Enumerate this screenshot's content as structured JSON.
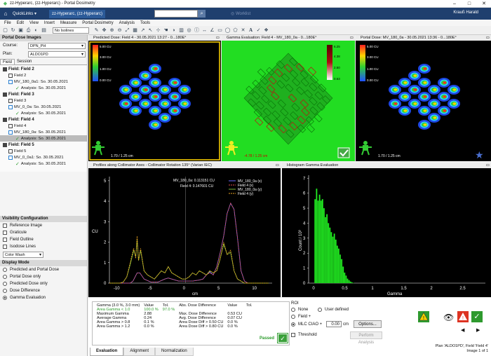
{
  "window": {
    "title": "zz-Hyperarc, (zz-Hyperarc) - Portal Dosimetry",
    "minimize": "–",
    "maximize": "□",
    "close": "✕"
  },
  "ribbon": {
    "quicklinks": "QuickLinks ▾",
    "patient_tab": "zz-Hyperarc, (zz-Hyperarc)",
    "worklist": "Worklist",
    "user": "Krauß Harald"
  },
  "menu": [
    "File",
    "Edit",
    "View",
    "Insert",
    "Measure",
    "Portal Dosimetry",
    "Analysis",
    "Tools"
  ],
  "toolbar": {
    "isolines": "No Isolines"
  },
  "left_panel": {
    "header": "Portal Dose Images",
    "course_label": "Course:",
    "course_value": "DPN_PH",
    "plan_label": "Plan:",
    "plan_value": "ALDO1PD",
    "tabs": [
      "Field",
      "Session"
    ],
    "tree": [
      {
        "field": "Field: Field 2",
        "items": [
          {
            "label": "Field 2",
            "kind": "box"
          },
          {
            "label": "MV_180_0a1: So. 30.05.2021",
            "kind": "doc"
          },
          {
            "label": "Analysis: So. 30.05.2021",
            "kind": "check"
          }
        ]
      },
      {
        "field": "Field: Field 3",
        "items": [
          {
            "label": "Field 3",
            "kind": "box"
          },
          {
            "label": "MV_0_0a: So. 30.05.2021",
            "kind": "doc"
          },
          {
            "label": "Analysis: So. 30.05.2021",
            "kind": "check"
          }
        ]
      },
      {
        "field": "Field: Field 4",
        "items": [
          {
            "label": "Field 4",
            "kind": "box"
          },
          {
            "label": "MV_180_0a: So. 30.05.2021",
            "kind": "doc"
          },
          {
            "label": "Analysis: So. 30.05.2021",
            "kind": "check",
            "selected": true
          }
        ]
      },
      {
        "field": "Field: Field 5",
        "items": [
          {
            "label": "Field 5",
            "kind": "box"
          },
          {
            "label": "MV_0_0a1: So. 30.05.2021",
            "kind": "doc"
          },
          {
            "label": "Analysis: So. 30.05.2021",
            "kind": "check"
          }
        ]
      }
    ],
    "visibility_header": "Visibility Configuration",
    "visibility": [
      "Reference Image",
      "Graticule",
      "Field Outline",
      "Isodose Lines"
    ],
    "color_mode": "Color Wash",
    "display_header": "Display Mode",
    "display_modes": [
      {
        "label": "Predicted and Portal Dose",
        "on": false
      },
      {
        "label": "Portal Dose only",
        "on": false
      },
      {
        "label": "Predicted Dose only",
        "on": false
      },
      {
        "label": "Dose Difference",
        "on": false
      },
      {
        "label": "Gamma Evaluation",
        "on": true
      }
    ]
  },
  "images": {
    "predicted": {
      "title": "Predicted Dose: Field 4 - 30.05.2021 13:27 - 0...180E°",
      "scale": [
        "5.00 CU",
        "3.00 CU",
        "1.00 CU",
        "0.00 CU"
      ],
      "readout": "1.70 / 1.25 cm"
    },
    "gamma": {
      "title": "Gamma Evaluation: Field 4 - MV_180_0a - 0...180E°",
      "scale": [
        "6.25",
        "4.38",
        "2.50",
        "0.63"
      ],
      "readout": "-4.78 / 1.25 cm"
    },
    "portal": {
      "title": "Portal Dose: MV_180_0a - 30.05.2021 13:36 - 0...180E°",
      "scale": [
        "5.00 CU",
        "3.00 CU",
        "1.00 CU",
        "0.00 CU"
      ],
      "readout": "1.70 / 1.25 cm"
    }
  },
  "profile": {
    "title": "Profiles along Collimator Axes - Collimator Rotation 135° (Varian IEC)",
    "readout1": "MV_180_0a: 0.113151 CU",
    "readout2": "Field 4: 0.147601 CU",
    "ylabel": "CU",
    "xlabel": "cm",
    "legend": [
      "MV_180_0a (x)",
      "Field 4 (x)",
      "MV_180_0a (y)",
      "Field 4 (y)"
    ]
  },
  "histogram": {
    "title": "Histogram Gamma Evaluation",
    "ylabel": "Count / 10³",
    "xlabel": "Gamma"
  },
  "chart_data": [
    {
      "type": "line",
      "title": "Profiles along Collimator Axes - Collimator Rotation 135° (Varian IEC)",
      "xlabel": "cm",
      "ylabel": "CU",
      "xlim": [
        -11,
        12.5
      ],
      "ylim": [
        0,
        5.2
      ],
      "xticks": [
        -10,
        -5,
        0,
        5,
        10
      ],
      "yticks": [
        0,
        1,
        2,
        3,
        4,
        5
      ],
      "series": [
        {
          "name": "MV_180_0a (x)",
          "color": "#6b6bff",
          "x": [
            -11,
            -9,
            -8,
            -7.6,
            -7,
            -6.6,
            -6,
            -5,
            -4,
            -3,
            -2.5,
            -2,
            -1,
            0,
            1,
            2,
            2.5,
            3,
            3.5,
            4,
            4.5,
            5,
            5.5,
            6,
            6.5,
            7,
            7.5,
            8,
            8.5,
            9,
            10,
            11,
            12
          ],
          "y": [
            0,
            0,
            0,
            0.1,
            0.5,
            0.5,
            0.2,
            0.05,
            0.05,
            0.2,
            0.25,
            0.2,
            0.1,
            0.1,
            0.1,
            0.15,
            0.2,
            0.4,
            0.55,
            0.4,
            0.8,
            1.5,
            2.3,
            3.4,
            3.9,
            3.6,
            2.2,
            0.6,
            0.1,
            0,
            0,
            0,
            0
          ]
        },
        {
          "name": "Field 4 (x)",
          "color": "#e05050",
          "x": [
            -11,
            -9,
            -8,
            -7.6,
            -7,
            -6.6,
            -6,
            -5,
            -4,
            -3,
            -2.5,
            -2,
            -1,
            0,
            1,
            2,
            2.5,
            3,
            3.5,
            4,
            4.5,
            5,
            5.5,
            6,
            6.5,
            7,
            7.5,
            8,
            8.5,
            9,
            10,
            11,
            12
          ],
          "y": [
            0,
            0,
            0,
            0.1,
            0.5,
            0.5,
            0.2,
            0.05,
            0.05,
            0.2,
            0.25,
            0.2,
            0.1,
            0.1,
            0.1,
            0.15,
            0.2,
            0.4,
            0.5,
            0.4,
            0.8,
            1.5,
            2.3,
            3.4,
            3.9,
            3.6,
            2.2,
            0.6,
            0.1,
            0,
            0,
            0,
            0
          ]
        },
        {
          "name": "MV_180_0a (y)",
          "color": "#7ab83a",
          "x": [
            -11,
            -9.5,
            -9,
            -8.5,
            -8,
            -7.5,
            -7.2,
            -7,
            -6.8,
            -6.5,
            -6,
            -5.5,
            -5,
            -4.5,
            -4,
            -3.5,
            -3,
            -2.5,
            -2,
            -1.5,
            -1,
            -0.5,
            0,
            0.5,
            1,
            1.5,
            2,
            2.5,
            3,
            3.5,
            4,
            4.5,
            5,
            5.5,
            6,
            6.5,
            7,
            7.5,
            8,
            8.5,
            9,
            10,
            11,
            12
          ],
          "y": [
            0,
            0,
            0.05,
            0.3,
            0.9,
            1.6,
            1.3,
            2.1,
            1.1,
            1.6,
            0.6,
            0.4,
            0.3,
            0.2,
            0.4,
            0.6,
            0.5,
            0.8,
            0.5,
            0.4,
            0.3,
            0.2,
            0.2,
            0.3,
            0.5,
            0.4,
            0.6,
            0.5,
            0.4,
            0.6,
            0.5,
            0.6,
            1.2,
            1.9,
            1.4,
            1.5,
            0.6,
            0.2,
            0.1,
            0,
            0,
            0,
            0,
            0
          ]
        },
        {
          "name": "Field 4 (y)",
          "color": "#e6a020",
          "x": [
            -11,
            -9.5,
            -9,
            -8.5,
            -8,
            -7.5,
            -7.2,
            -7,
            -6.8,
            -6.5,
            -6,
            -5.5,
            -5,
            -4.5,
            -4,
            -3.5,
            -3,
            -2.5,
            -2,
            -1.5,
            -1,
            -0.5,
            0,
            0.5,
            1,
            1.5,
            2,
            2.5,
            3,
            3.5,
            4,
            4.5,
            5,
            5.5,
            6,
            6.5,
            7,
            7.5,
            8,
            8.5,
            9,
            10,
            11,
            12
          ],
          "y": [
            0,
            0,
            0.05,
            0.3,
            1.0,
            1.7,
            1.2,
            2.3,
            1.1,
            1.7,
            0.6,
            0.4,
            0.3,
            0.2,
            0.4,
            0.6,
            0.5,
            0.8,
            0.5,
            0.4,
            0.3,
            0.2,
            0.2,
            0.3,
            0.5,
            0.4,
            0.6,
            0.5,
            0.4,
            0.6,
            0.5,
            0.6,
            1.2,
            2.0,
            1.4,
            1.6,
            0.6,
            0.2,
            0.1,
            0,
            0,
            0,
            0,
            0
          ]
        }
      ]
    },
    {
      "type": "bar",
      "title": "Histogram Gamma Evaluation",
      "xlabel": "Gamma",
      "ylabel": "Count / 10³",
      "xlim": [
        -0.1,
        2.9
      ],
      "ylim": [
        0,
        7.2
      ],
      "xticks": [
        0,
        0.5,
        1,
        1.5,
        2,
        2.5
      ],
      "yticks": [
        0,
        1,
        2,
        3,
        4,
        5,
        6,
        7
      ],
      "bin_width": 0.025,
      "x": [
        0.0,
        0.025,
        0.05,
        0.075,
        0.1,
        0.125,
        0.15,
        0.175,
        0.2,
        0.225,
        0.25,
        0.275,
        0.3,
        0.325,
        0.35,
        0.375,
        0.4,
        0.425,
        0.45,
        0.475,
        0.5,
        0.525,
        0.55,
        0.575,
        0.6,
        0.625,
        0.65
      ],
      "values": [
        5.6,
        6.3,
        5.5,
        5.9,
        5.5,
        5.6,
        5.0,
        4.4,
        4.6,
        4.0,
        3.7,
        3.4,
        3.1,
        3.3,
        2.9,
        2.5,
        2.3,
        1.9,
        1.6,
        1.1,
        0.7,
        0.5,
        0.3,
        0.2,
        0.1,
        0.05,
        0.02
      ]
    }
  ],
  "evaluation": {
    "headers": [
      "Gamma (3.0 %, 3.0 mm)",
      "Value",
      "Tol.",
      "Abs. Dose Difference",
      "Value",
      "Tol."
    ],
    "left_rows": [
      {
        "label": "Area Gamma < 1.0",
        "value": "100.0 %",
        "tol": "97.0 %",
        "green": true
      },
      {
        "label": "Maximum Gamma",
        "value": "2.88",
        "tol": "",
        "green": false
      },
      {
        "label": "Average Gamma",
        "value": "0.24",
        "tol": "",
        "green": false
      },
      {
        "label": "Area Gamma > 0.8",
        "value": "0.1 %",
        "tol": "",
        "green": false
      },
      {
        "label": "Area Gamma > 1.2",
        "value": "0.0 %",
        "tol": "",
        "green": false
      }
    ],
    "right_rows": [
      {
        "label": "Max. Dose Difference",
        "value": "0.53 CU"
      },
      {
        "label": "Avg. Dose Difference",
        "value": "0.07 CU"
      },
      {
        "label": "Area Dose Diff > 0.50 CU",
        "value": "0.0 %"
      },
      {
        "label": "Area Dose Diff > 0.80 CU",
        "value": "0.0 %"
      }
    ],
    "status": "Passed",
    "tabs": [
      "Evaluation",
      "Alignment",
      "Normalization"
    ]
  },
  "roi": {
    "header": "ROI",
    "none": "None",
    "user": "User defined",
    "field": "Field +",
    "mlc": "MLC CIAO +",
    "mlc_value": "0.00",
    "unit": "cm",
    "options": "Options...",
    "threshold": "Threshold",
    "analysis_btn": "Perform Analysis"
  },
  "footer": {
    "plan": "Plan 'ALDO1PD', Field 'Field 4'",
    "image": "Image 1 of 1"
  }
}
